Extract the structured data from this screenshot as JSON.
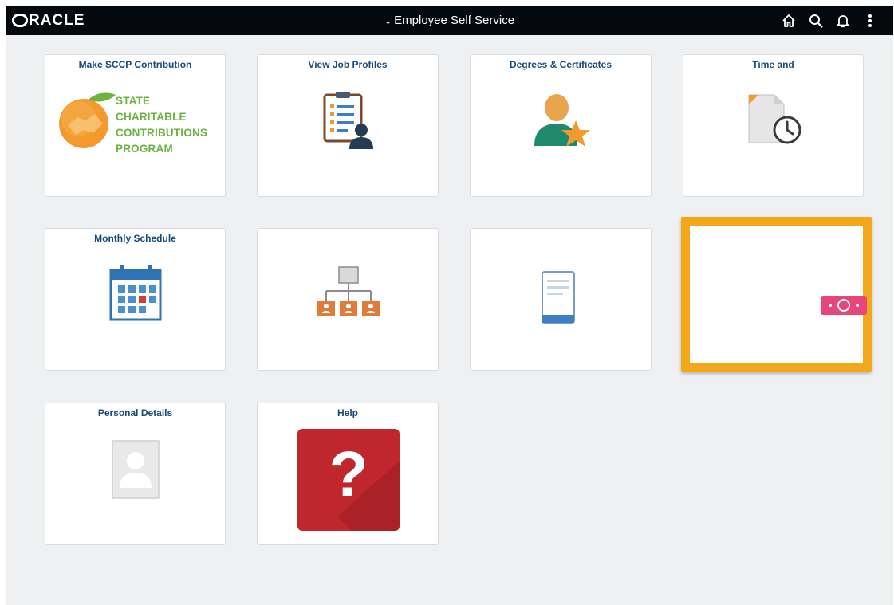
{
  "header": {
    "logo_text": "RACLE",
    "nav_title": "Employee Self Service",
    "nav_chevron": "⌄",
    "icons": [
      "home-icon",
      "search-icon",
      "bell-icon",
      "kebab-menu-icon"
    ]
  },
  "tiles": [
    {
      "title": "Make SCCP Contribution",
      "art_text": [
        "STATE",
        "CHARITABLE",
        "CONTRIBUTIONS",
        "PROGRAM"
      ]
    },
    {
      "title": "View Job Profiles"
    },
    {
      "title": "Degrees & Certificates"
    },
    {
      "title": "Time and Absence",
      "title_visible": "Time and"
    },
    {
      "title": "Monthly Schedule"
    },
    {
      "title": ""
    },
    {
      "title": ""
    },
    {
      "title": "",
      "selected": true
    },
    {
      "title": "Personal Details"
    },
    {
      "title": "Help"
    }
  ],
  "colors": {
    "header_bg": "#05080c",
    "page_bg": "#eef0f2",
    "tile_title": "#174a7c",
    "selected_border": "#f3a81c",
    "sccp_green": "#6db33f",
    "help_red": "#c0272d"
  }
}
